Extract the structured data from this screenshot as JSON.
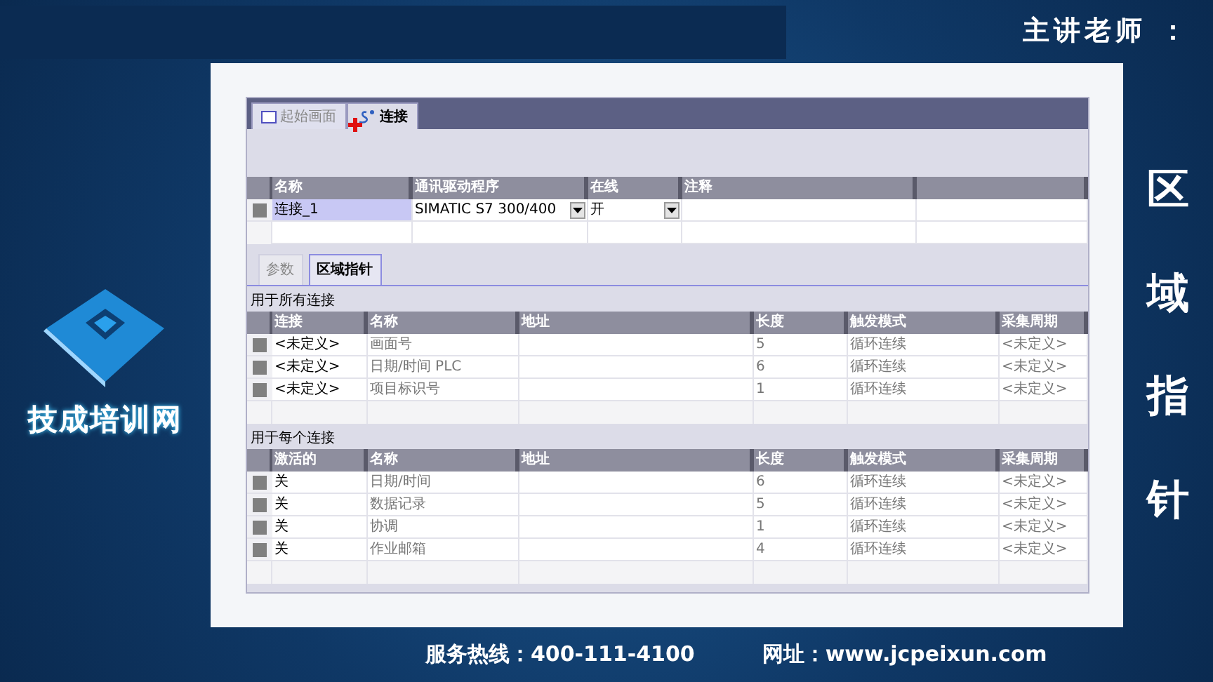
{
  "header": {
    "presenter_label": "主讲老师 ："
  },
  "brand": {
    "name": "技成培训网"
  },
  "side_title": "区域指针",
  "window": {
    "tabs": [
      {
        "label": "起始画面",
        "selected": false
      },
      {
        "label": "连接",
        "selected": true
      }
    ],
    "connections": {
      "columns": [
        "名称",
        "通讯驱动程序",
        "在线",
        "注释"
      ],
      "rows": [
        {
          "name": "连接_1",
          "driver": "SIMATIC S7 300/400",
          "online": "开",
          "selected": true
        }
      ]
    },
    "sub_tabs": [
      {
        "label": "参数",
        "selected": false
      },
      {
        "label": "区域指针",
        "selected": true
      }
    ],
    "sections": [
      {
        "title": "用于所有连接",
        "columns": [
          "连接",
          "名称",
          "地址",
          "长度",
          "触发模式",
          "采集周期"
        ],
        "rows": [
          {
            "first": "<未定义>",
            "name": "画面号",
            "length": "5",
            "trigger": "循环连续",
            "cycle": "<未定义>"
          },
          {
            "first": "<未定义>",
            "name": "日期/时间 PLC",
            "length": "6",
            "trigger": "循环连续",
            "cycle": "<未定义>"
          },
          {
            "first": "<未定义>",
            "name": "项目标识号",
            "length": "1",
            "trigger": "循环连续",
            "cycle": "<未定义>"
          }
        ]
      },
      {
        "title": "用于每个连接",
        "columns": [
          "激活的",
          "名称",
          "地址",
          "长度",
          "触发模式",
          "采集周期"
        ],
        "rows": [
          {
            "first": "关",
            "name": "日期/时间",
            "length": "6",
            "trigger": "循环连续",
            "cycle": "<未定义>"
          },
          {
            "first": "关",
            "name": "数据记录",
            "length": "5",
            "trigger": "循环连续",
            "cycle": "<未定义>"
          },
          {
            "first": "关",
            "name": "协调",
            "length": "1",
            "trigger": "循环连续",
            "cycle": "<未定义>"
          },
          {
            "first": "关",
            "name": "作业邮箱",
            "length": "4",
            "trigger": "循环连续",
            "cycle": "<未定义>"
          }
        ]
      }
    ]
  },
  "footer": {
    "hotline": "服务热线：400-111-4100",
    "website": "网址：www.jcpeixun.com"
  }
}
